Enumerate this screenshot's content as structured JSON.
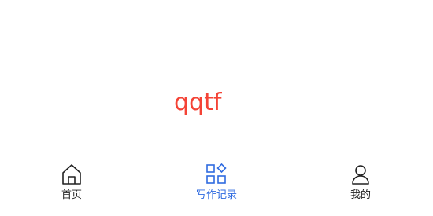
{
  "main": {
    "text": "qqtf"
  },
  "tabbar": {
    "items": [
      {
        "label": "首页",
        "icon": "home-icon",
        "active": false
      },
      {
        "label": "写作记录",
        "icon": "grid-icon",
        "active": true
      },
      {
        "label": "我的",
        "icon": "user-icon",
        "active": false
      }
    ]
  },
  "colors": {
    "accent": "#2f6be0",
    "main_text": "#f44336",
    "tab_text": "#222222",
    "background": "#ffffff"
  }
}
